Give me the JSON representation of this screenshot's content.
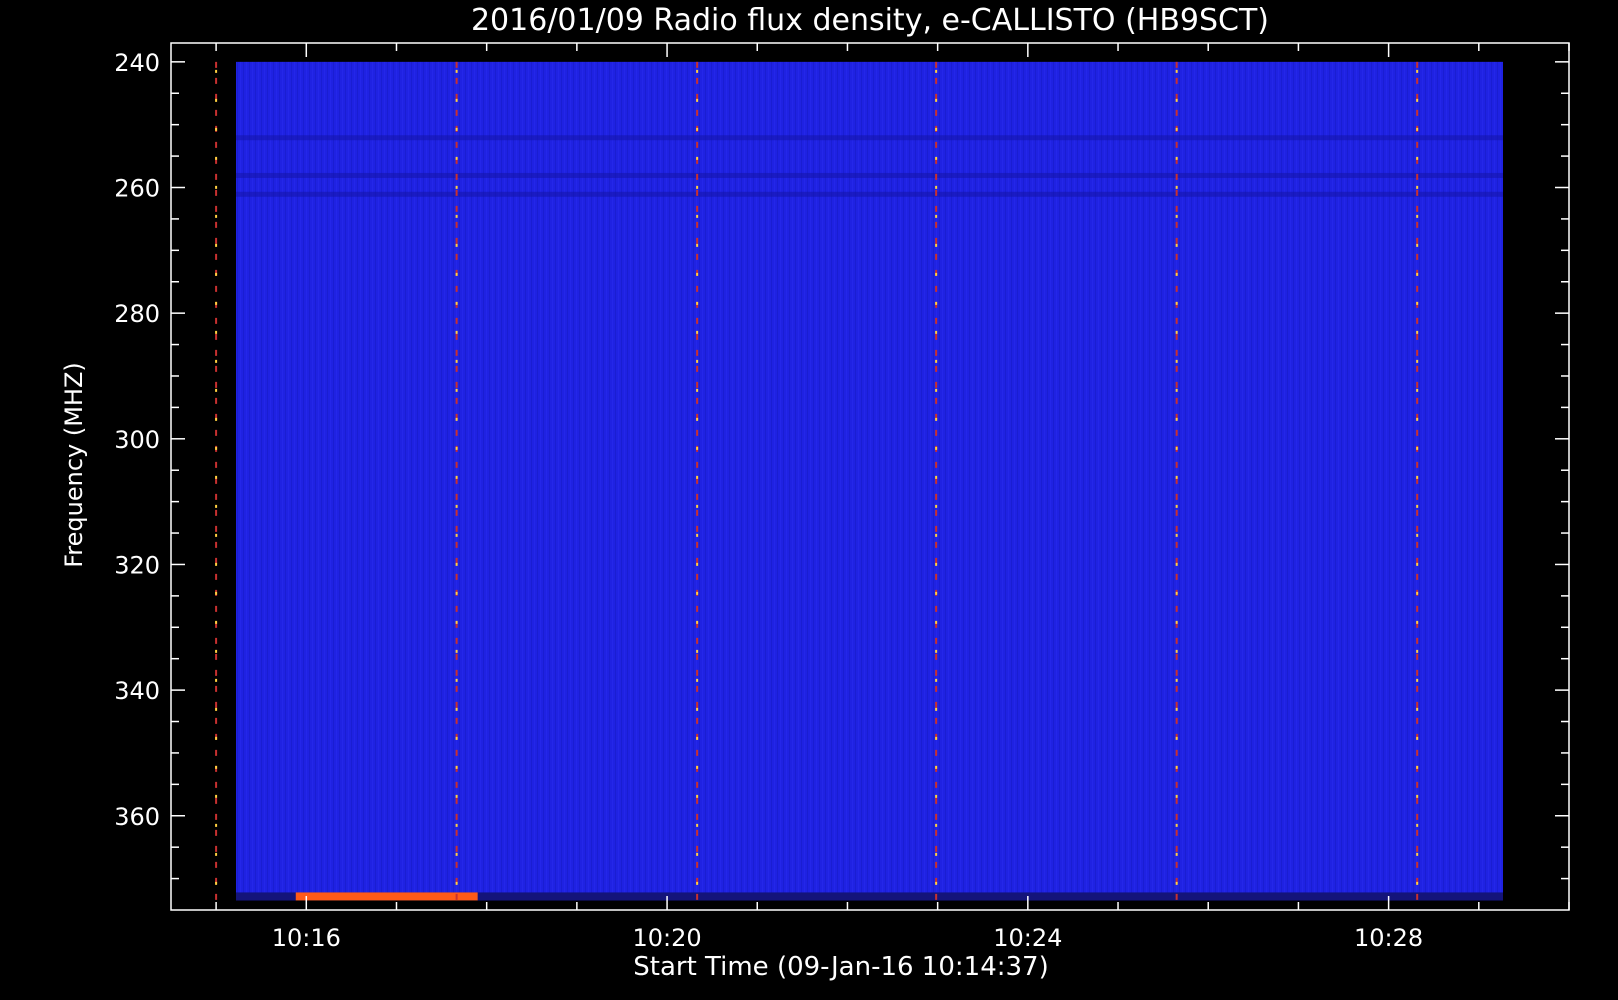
{
  "chart_data": {
    "type": "heatmap",
    "title": "2016/01/09  Radio flux density, e-CALLISTO (HB9SCT)",
    "xlabel": "Start Time (09-Jan-16 10:14:37)",
    "ylabel": "Frequency (MHZ)",
    "x_start": "10:14:37",
    "x_range_minutes": [
      10.25,
      10.5
    ],
    "xlim": [
      "10:14:30",
      "10:30:00"
    ],
    "ylim": [
      237,
      375
    ],
    "y_inverted": true,
    "x_major_ticks": [
      "10:16",
      "10:20",
      "10:24",
      "10:28"
    ],
    "y_major_ticks": [
      240,
      260,
      280,
      300,
      320,
      340,
      360
    ],
    "background_color": "#1f1fe6",
    "colormap": [
      "#000000",
      "#1010a0",
      "#2020e8",
      "#c02020",
      "#ff6020",
      "#ffd040"
    ],
    "features": {
      "vertical_interference_lines": [
        "10:15:00",
        "10:17:40",
        "10:20:20",
        "10:22:59",
        "10:25:39",
        "10:28:19"
      ],
      "dark_horizontal_bands_mhz": [
        252,
        258,
        261
      ],
      "bright_bottom_segment": {
        "start": "10:15:53",
        "end": "10:17:54",
        "frequency_mhz": 373
      }
    }
  }
}
